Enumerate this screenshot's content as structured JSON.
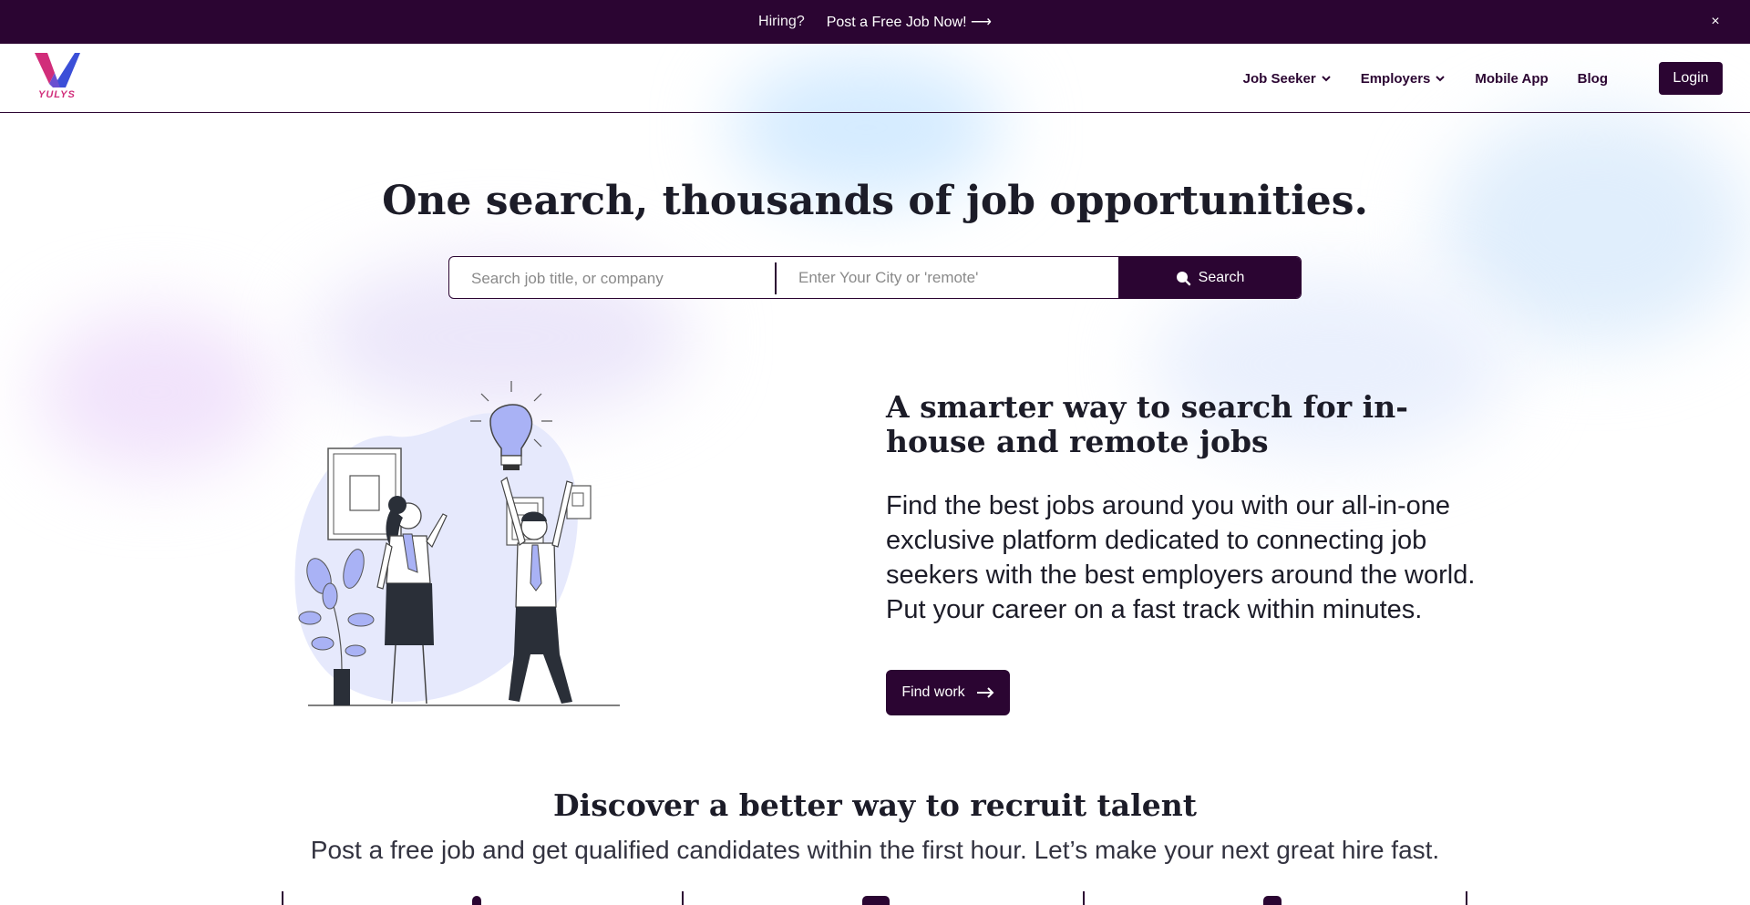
{
  "announcement": {
    "hiring": "Hiring?",
    "post_link": "Post a Free Job Now! ⟶",
    "close": "×"
  },
  "header": {
    "logo_text": "YULYS",
    "nav": [
      {
        "label": "Job Seeker",
        "dropdown": true
      },
      {
        "label": "Employers",
        "dropdown": true
      },
      {
        "label": "Mobile App",
        "dropdown": false
      },
      {
        "label": "Blog",
        "dropdown": false
      }
    ],
    "login_label": "Login"
  },
  "hero": {
    "title": "One search, thousands of job opportunities.",
    "job_placeholder": "Search job title, or company",
    "city_placeholder": "Enter Your City or 'remote'",
    "search_label": "Search"
  },
  "feature": {
    "title": "A smarter way to search for in-house and remote jobs",
    "body": "Find the best jobs around you with our all-in-one exclusive platform dedicated to connecting job seekers with the best employers around the world. Put your career on a fast track within minutes.",
    "cta_label": "Find work"
  },
  "discover": {
    "title": "Discover a better way to recruit talent",
    "subtitle": "Post a free job and get qualified candidates within the first hour. Let’s make your next great hire fast."
  },
  "colors": {
    "brand_dark": "#2b0532",
    "logo_pink": "#d12d7a",
    "logo_blue": "#3b4fd8",
    "illustration_lavender": "#a9b2f5"
  }
}
